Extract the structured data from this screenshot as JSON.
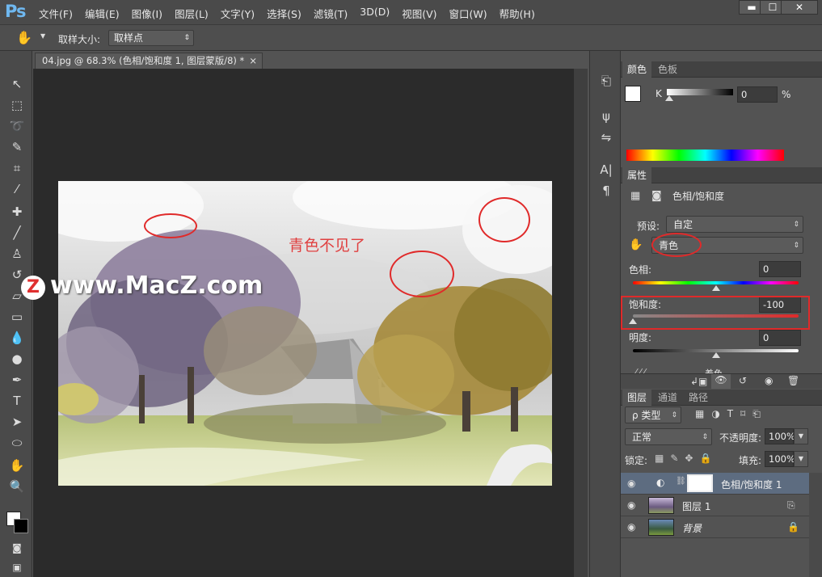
{
  "app": {
    "logo": "Ps"
  },
  "menu": [
    "文件(F)",
    "编辑(E)",
    "图像(I)",
    "图层(L)",
    "文字(Y)",
    "选择(S)",
    "滤镜(T)",
    "3D(D)",
    "视图(V)",
    "窗口(W)",
    "帮助(H)"
  ],
  "window_controls": {
    "minimize": "▬",
    "maximize": "☐",
    "close": "✕"
  },
  "options_bar": {
    "label": "取样大小:",
    "value": "取样点"
  },
  "document": {
    "tab_title": "04.jpg @ 68.3% (色相/饱和度 1, 图层蒙版/8) *",
    "close": "×"
  },
  "annotation_text": "青色不见了",
  "watermark": {
    "badge": "Z",
    "text": "www.MacZ.com"
  },
  "color_panel": {
    "tabs": [
      "颜色",
      "色板"
    ],
    "channel": "K",
    "value": "0",
    "unit": "%"
  },
  "properties_panel": {
    "tab": "属性",
    "title": "色相/饱和度",
    "preset_label": "预设:",
    "preset_value": "自定",
    "channel_value": "青色",
    "hue_label": "色相:",
    "hue_value": "0",
    "saturation_label": "饱和度:",
    "saturation_value": "-100",
    "lightness_label": "明度:",
    "lightness_value": "0",
    "colorize_label": "着色"
  },
  "layers_panel": {
    "tabs": [
      "图层",
      "通道",
      "路径"
    ],
    "filter": "ρ 类型",
    "blend_mode": "正常",
    "opacity_label": "不透明度:",
    "opacity_value": "100%",
    "lock_label": "锁定:",
    "fill_label": "填充:",
    "fill_value": "100%",
    "layers": [
      {
        "name": "色相/饱和度 1"
      },
      {
        "name": "图层 1"
      },
      {
        "name": "背景"
      }
    ]
  },
  "colors": {
    "annotation_red": "#e02a2a",
    "panel_bg": "#535353",
    "selected_layer": "#5d6c80"
  }
}
